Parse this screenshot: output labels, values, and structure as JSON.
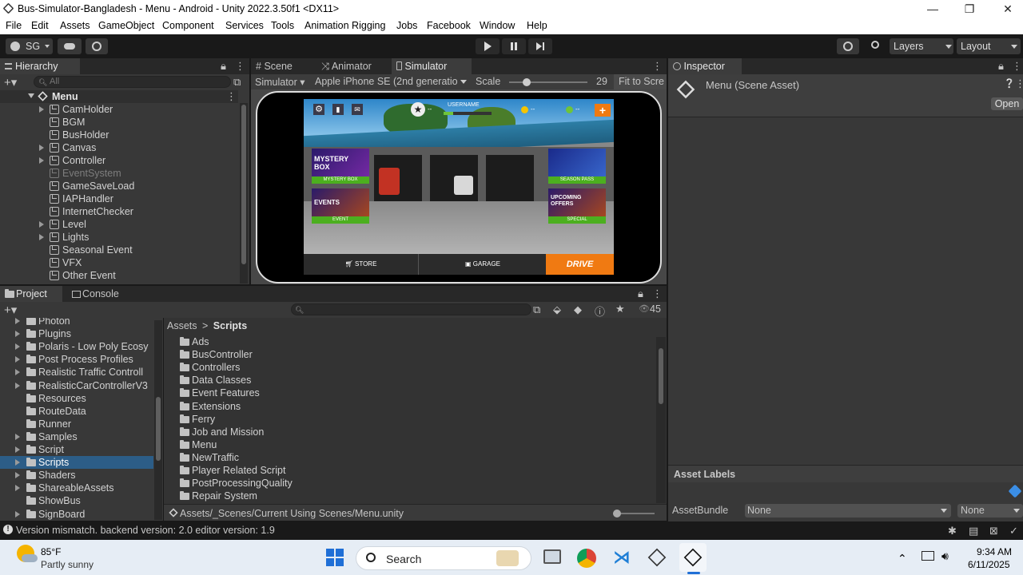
{
  "window": {
    "title": "Bus-Simulator-Bangladesh - Menu - Android - Unity 2022.3.50f1 <DX11>",
    "minimize": "—",
    "maximize": "❐",
    "close": "✕"
  },
  "menubar": [
    "File",
    "Edit",
    "Assets",
    "GameObject",
    "Component",
    "Services",
    "Tools",
    "Animation Rigging",
    "Jobs",
    "Facebook",
    "Window",
    "Help"
  ],
  "toolbar": {
    "account": "SG",
    "layers": "Layers",
    "layout": "Layout"
  },
  "hierarchy": {
    "tab": "Hierarchy",
    "search_placeholder": "All",
    "root": "Menu",
    "items": [
      {
        "label": "CamHolder",
        "expandable": true,
        "disabled": false
      },
      {
        "label": "BGM",
        "expandable": false,
        "disabled": false
      },
      {
        "label": "BusHolder",
        "expandable": false,
        "disabled": false
      },
      {
        "label": "Canvas",
        "expandable": true,
        "disabled": false
      },
      {
        "label": "Controller",
        "expandable": true,
        "disabled": false
      },
      {
        "label": "EventSystem",
        "expandable": false,
        "disabled": true
      },
      {
        "label": "GameSaveLoad",
        "expandable": false,
        "disabled": false
      },
      {
        "label": "IAPHandler",
        "expandable": false,
        "disabled": false
      },
      {
        "label": "InternetChecker",
        "expandable": false,
        "disabled": false
      },
      {
        "label": "Level",
        "expandable": true,
        "disabled": false
      },
      {
        "label": "Lights",
        "expandable": true,
        "disabled": false
      },
      {
        "label": "Seasonal Event",
        "expandable": false,
        "disabled": false
      },
      {
        "label": "VFX",
        "expandable": false,
        "disabled": false
      },
      {
        "label": "Other Event",
        "expandable": false,
        "disabled": false
      }
    ]
  },
  "scene_tabs": {
    "scene": "Scene",
    "animator": "Animator",
    "simulator": "Simulator"
  },
  "simulator_bar": {
    "mode": "Simulator",
    "device": "Apple iPhone SE (2nd generatio",
    "scale_label": "Scale",
    "scale_value": "29",
    "fit": "Fit to Scre"
  },
  "game": {
    "username": "USERNAME",
    "star_value": "--",
    "coin_value": "--",
    "cash_value": "--",
    "mystery_title": "MYSTERY BOX",
    "mystery_label": "MYSTERY BOX",
    "events_title": "EVENTS",
    "events_label": "EVENT",
    "season_label": "SEASON PASS",
    "upcoming_title": "UPCOMING OFFERS",
    "special_label": "SPECIAL",
    "store": "STORE",
    "garage": "GARAGE",
    "drive": "DRIVE"
  },
  "inspector": {
    "tab": "Inspector",
    "title": "Menu (Scene Asset)",
    "open": "Open",
    "asset_labels": "Asset Labels",
    "asset_bundle": "AssetBundle",
    "bundle_value": "None",
    "variant_value": "None"
  },
  "project": {
    "tab_project": "Project",
    "tab_console": "Console",
    "hidden_count": "45",
    "tree": [
      {
        "label": "Photon",
        "expandable": true
      },
      {
        "label": "Plugins",
        "expandable": true
      },
      {
        "label": "Polaris - Low Poly Ecosy",
        "expandable": true
      },
      {
        "label": "Post Process Profiles",
        "expandable": true
      },
      {
        "label": "Realistic Traffic Controll",
        "expandable": true
      },
      {
        "label": "RealisticCarControllerV3",
        "expandable": true
      },
      {
        "label": "Resources",
        "expandable": false
      },
      {
        "label": "RouteData",
        "expandable": false
      },
      {
        "label": "Runner",
        "expandable": false
      },
      {
        "label": "Samples",
        "expandable": true
      },
      {
        "label": "Script",
        "expandable": true
      },
      {
        "label": "Scripts",
        "expandable": true,
        "selected": true
      },
      {
        "label": "Shaders",
        "expandable": true
      },
      {
        "label": "ShareableAssets",
        "expandable": true
      },
      {
        "label": "ShowBus",
        "expandable": false
      },
      {
        "label": "SignBoard",
        "expandable": true
      }
    ],
    "breadcrumb_root": "Assets",
    "breadcrumb_sep": ">",
    "breadcrumb_current": "Scripts",
    "folders": [
      "Ads",
      "BusController",
      "Controllers",
      "Data Classes",
      "Event Features",
      "Extensions",
      "Ferry",
      "Job and Mission",
      "Menu",
      "NewTraffic",
      "Player Related Script",
      "PostProcessingQuality",
      "Repair System"
    ],
    "path": "Assets/_Scenes/Current Using Scenes/Menu.unity"
  },
  "status": {
    "message": "Version mismatch. backend version: 2.0 editor version: 1.9"
  },
  "taskbar": {
    "temp": "85°F",
    "weather": "Partly sunny",
    "search": "Search",
    "time": "9:34 AM",
    "date": "6/11/2025"
  },
  "colors": {
    "accent_selection": "#2c5d87",
    "drive_orange": "#f07a12",
    "panel": "#383838",
    "tabbar": "#282828"
  }
}
